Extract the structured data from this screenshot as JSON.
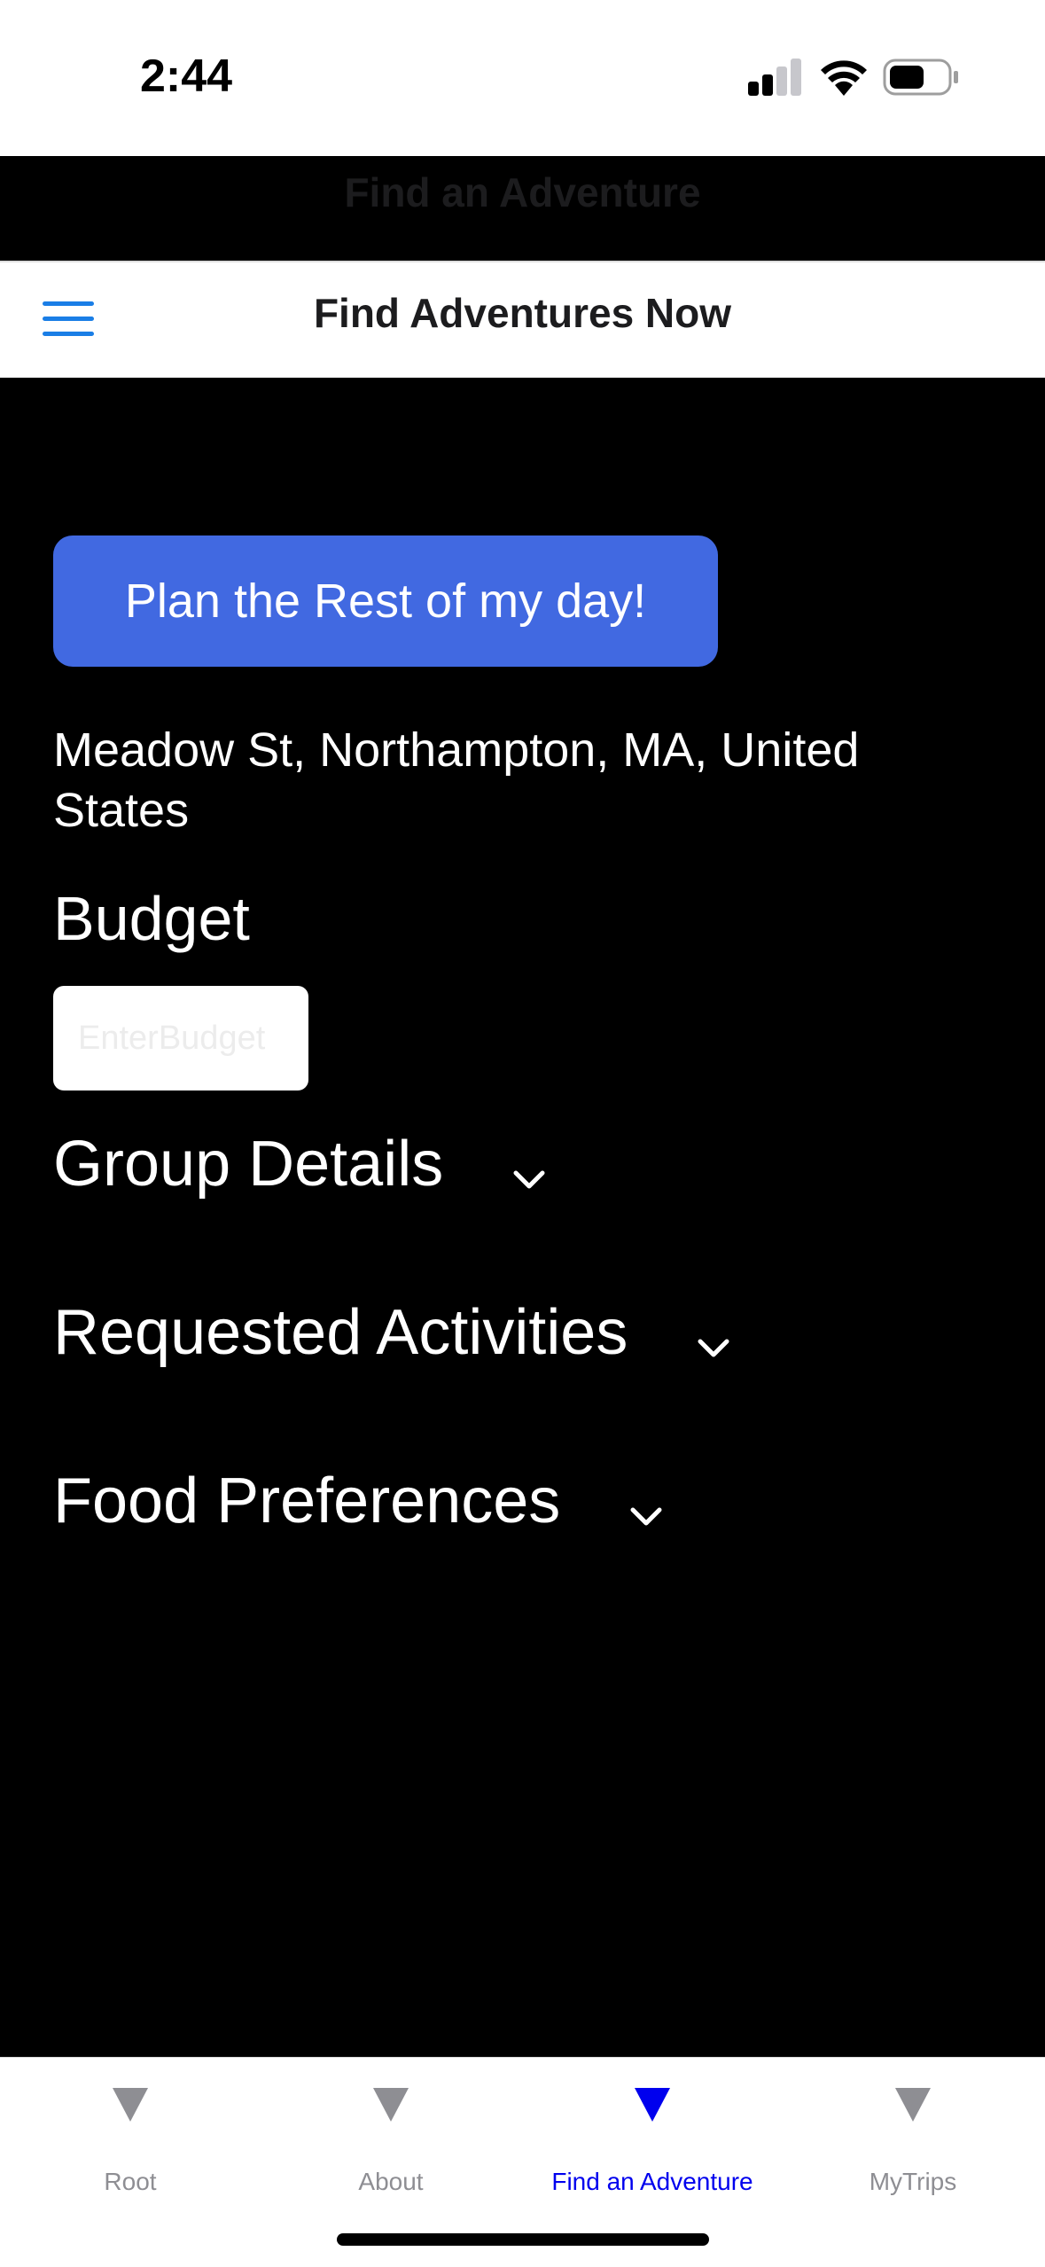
{
  "status_bar": {
    "time": "2:44",
    "icons": [
      "signal-icon",
      "wifi-icon",
      "battery-icon"
    ]
  },
  "nav": {
    "title": "Find an Adventure"
  },
  "header": {
    "menu_icon": "hamburger-menu-icon",
    "title": "Find Adventures Now"
  },
  "main": {
    "plan_button_label": "Plan the Rest of my day!",
    "address": "Meadow St, Northampton, MA, United States",
    "budget": {
      "label": "Budget",
      "placeholder": "EnterBudget",
      "value": ""
    },
    "sections": [
      {
        "label": "Group Details",
        "icon": "chevron-down-icon"
      },
      {
        "label": "Requested Activities",
        "icon": "chevron-down-icon"
      },
      {
        "label": "Food Preferences",
        "icon": "chevron-down-icon"
      }
    ]
  },
  "tab_bar": {
    "tabs": [
      {
        "label": "Root",
        "icon": "triangle-down-icon",
        "active": false
      },
      {
        "label": "About",
        "icon": "triangle-down-icon",
        "active": false
      },
      {
        "label": "Find an Adventure",
        "icon": "triangle-down-icon",
        "active": true
      },
      {
        "label": "MyTrips",
        "icon": "triangle-down-icon",
        "active": false
      }
    ]
  },
  "colors": {
    "accent_button": "#4169e1",
    "active_tab": "#0000ee",
    "inactive_tab": "#8e8e93",
    "menu_icon": "#1a7ee6",
    "content_background": "#000000"
  }
}
